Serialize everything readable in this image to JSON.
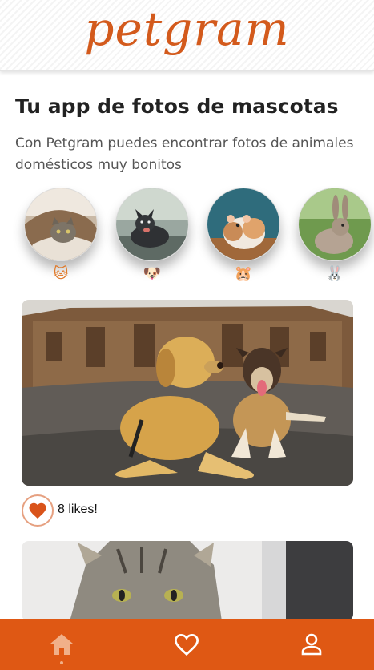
{
  "app": {
    "logo_text": "petgram"
  },
  "intro": {
    "title": "Tu app de fotos de mascotas",
    "subtitle": "Con Petgram puedes encontrar fotos de animales domésticos muy bonitos"
  },
  "categories": [
    {
      "name": "cats",
      "emoji": "🐱"
    },
    {
      "name": "dogs",
      "emoji": "🐶"
    },
    {
      "name": "hamsters",
      "emoji": "🐹"
    },
    {
      "name": "rabbits",
      "emoji": "🐰"
    }
  ],
  "photos": [
    {
      "subject": "two dogs lying on a plaza",
      "likes_text": "8 likes!"
    },
    {
      "subject": "tabby cat"
    }
  ],
  "nav": {
    "items": [
      {
        "name": "home",
        "icon": "home-icon",
        "active": true
      },
      {
        "name": "favorites",
        "icon": "heart-outline-icon",
        "active": false
      },
      {
        "name": "user",
        "icon": "user-icon",
        "active": false
      }
    ]
  },
  "colors": {
    "brand": "#df5814",
    "logo": "#d35a1c",
    "heart": "#d9531a",
    "nav_active": "#f1b089",
    "nav_icon": "#ffffff"
  }
}
